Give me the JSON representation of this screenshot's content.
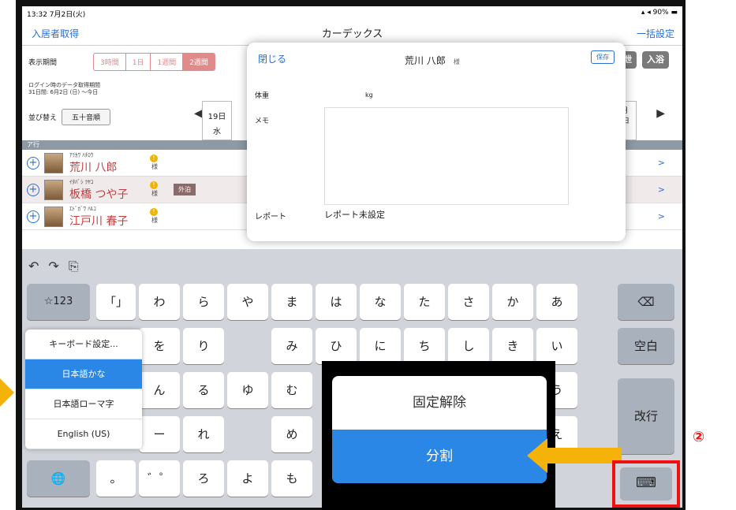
{
  "status": {
    "time_date": "13:32 7月2日(火)",
    "battery": "90%"
  },
  "nav": {
    "back": "入居者取得",
    "title": "カーデックス",
    "right": "一括設定"
  },
  "period": {
    "label": "表示期間",
    "options": [
      "3時間",
      "1日",
      "1週間",
      "2週間"
    ],
    "selected": "2週間"
  },
  "tags": [
    "排泄",
    "入浴"
  ],
  "info": [
    "ログイン時のデータ取得期間",
    "31日間: 6月2日 (日) ～今日"
  ],
  "sort": {
    "label": "並び替え",
    "value": "五十音順"
  },
  "dates": [
    {
      "d": "19日",
      "w": "水"
    },
    {
      "d": "7月 今日",
      "w": "火"
    }
  ],
  "section": "ア行",
  "residents": [
    {
      "kana": "ｱﾗｶﾜ ﾊﾁﾛｳ",
      "name": "荒川 八郎",
      "sama": "様",
      "badge": ""
    },
    {
      "kana": "ｲﾀﾊﾞｼ ﾂﾔｺ",
      "name": "板橋 つや子",
      "sama": "様",
      "badge": "外泊"
    },
    {
      "kana": "ｴﾄﾞｶﾞﾜ ﾊﾙｺ",
      "name": "江戸川 春子",
      "sama": "様",
      "badge": ""
    }
  ],
  "popover": {
    "close": "閉じる",
    "name": "荒川 八郎",
    "sama": "様",
    "save": "保存",
    "weight_label": "体重",
    "weight_unit": "kg",
    "memo_label": "メモ",
    "report_label": "レポート",
    "report_value": "レポート未設定"
  },
  "keyboard": {
    "row1": [
      "☆123",
      "「」",
      "わ",
      "ら",
      "や",
      "ま",
      "は",
      "な",
      "た",
      "さ",
      "か",
      "あ"
    ],
    "row2": [
      "を",
      "り",
      "",
      "み",
      "ひ",
      "に",
      "ち",
      "し",
      "き",
      "い"
    ],
    "row3": [
      "ん",
      "る",
      "ゆ",
      "む",
      "う"
    ],
    "row4": [
      "ー",
      "れ",
      "",
      "め",
      "え"
    ],
    "row5": [
      "。",
      "゛゜",
      "ろ",
      "よ",
      "も"
    ],
    "space": "空白",
    "enter": "改行",
    "delete": "⌫",
    "globe": "🌐"
  },
  "lang_menu": [
    "キーボード設定...",
    "日本語かな",
    "日本語ローマ字",
    "English (US)"
  ],
  "lang_selected": "日本語かな",
  "callout": {
    "opt1": "固定解除",
    "opt2": "分割"
  },
  "step": "②"
}
